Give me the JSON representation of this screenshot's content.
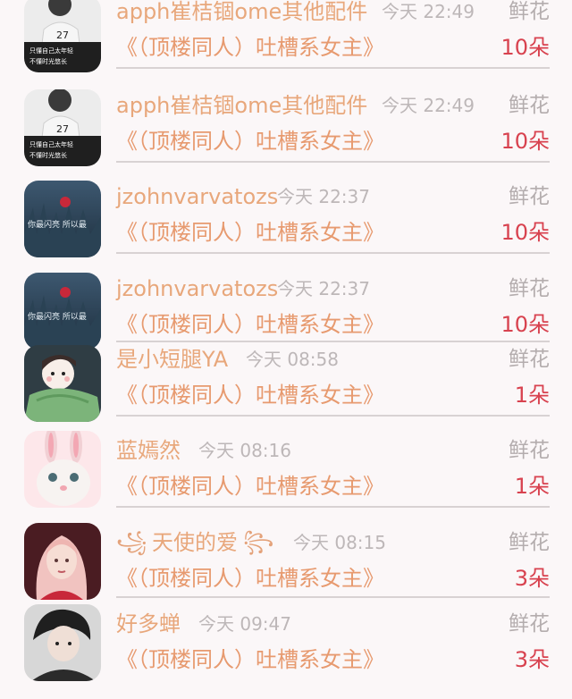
{
  "list": [
    {
      "user": "apph崔桔锢ome其他配件",
      "time": "今天 22:49",
      "gift": "鲜花",
      "book": "《（顶楼同人）吐槽系女主》",
      "count": "10朵",
      "avatar": "boy-shirt-27",
      "avatar_caption_1": "只懂自己太年轻",
      "avatar_caption_2": "不懂时光悠长"
    },
    {
      "user": "apph崔桔锢ome其他配件",
      "time": "今天 22:49",
      "gift": "鲜花",
      "book": "《（顶楼同人）吐槽系女主》",
      "count": "10朵",
      "avatar": "boy-shirt-27",
      "avatar_caption_1": "只懂自己太年轻",
      "avatar_caption_2": "不懂时光悠长"
    },
    {
      "user": "jzohnvarvatozs",
      "time": "今天 22:37",
      "gift": "鲜花",
      "book": "《（顶楼同人）吐槽系女主》",
      "count": "10朵",
      "avatar": "blue-field-rose",
      "avatar_caption_1": "你最闪亮  所以最"
    },
    {
      "user": "jzohnvarvatozs",
      "time": "今天 22:37",
      "gift": "鲜花",
      "book": "《（顶楼同人）吐槽系女主》",
      "count": "10朵",
      "avatar": "blue-field-rose",
      "avatar_caption_1": "你最闪亮  所以最"
    },
    {
      "user": "是小短腿YA",
      "time": "今天 08:58",
      "gift": "鲜花",
      "book": "《（顶楼同人）吐槽系女主》",
      "count": "1朵",
      "avatar": "cartoon-girl-blanket"
    },
    {
      "user": "蓝嫣然",
      "time": "今天 08:16",
      "gift": "鲜花",
      "book": "《（顶楼同人）吐槽系女主》",
      "count": "1朵",
      "avatar": "white-bunny"
    },
    {
      "user": "天使的爱",
      "time": "今天 08:15",
      "gift": "鲜花",
      "book": "《（顶楼同人）吐槽系女主》",
      "count": "3朵",
      "avatar": "pink-hair-girl"
    },
    {
      "user": "好多蝉",
      "time": "今天 09:47",
      "gift": "鲜花",
      "book": "《（顶楼同人）吐槽系女主》",
      "count": "3朵",
      "avatar": "dark-hair-person"
    }
  ],
  "colors": {
    "username": "#e8a77b",
    "time": "#bdb7b8",
    "gift_type": "#b4adae",
    "book_title": "#e79a6f",
    "count": "#d8424f",
    "divider": "#d8d2d3",
    "background": "#fbf7f8"
  }
}
